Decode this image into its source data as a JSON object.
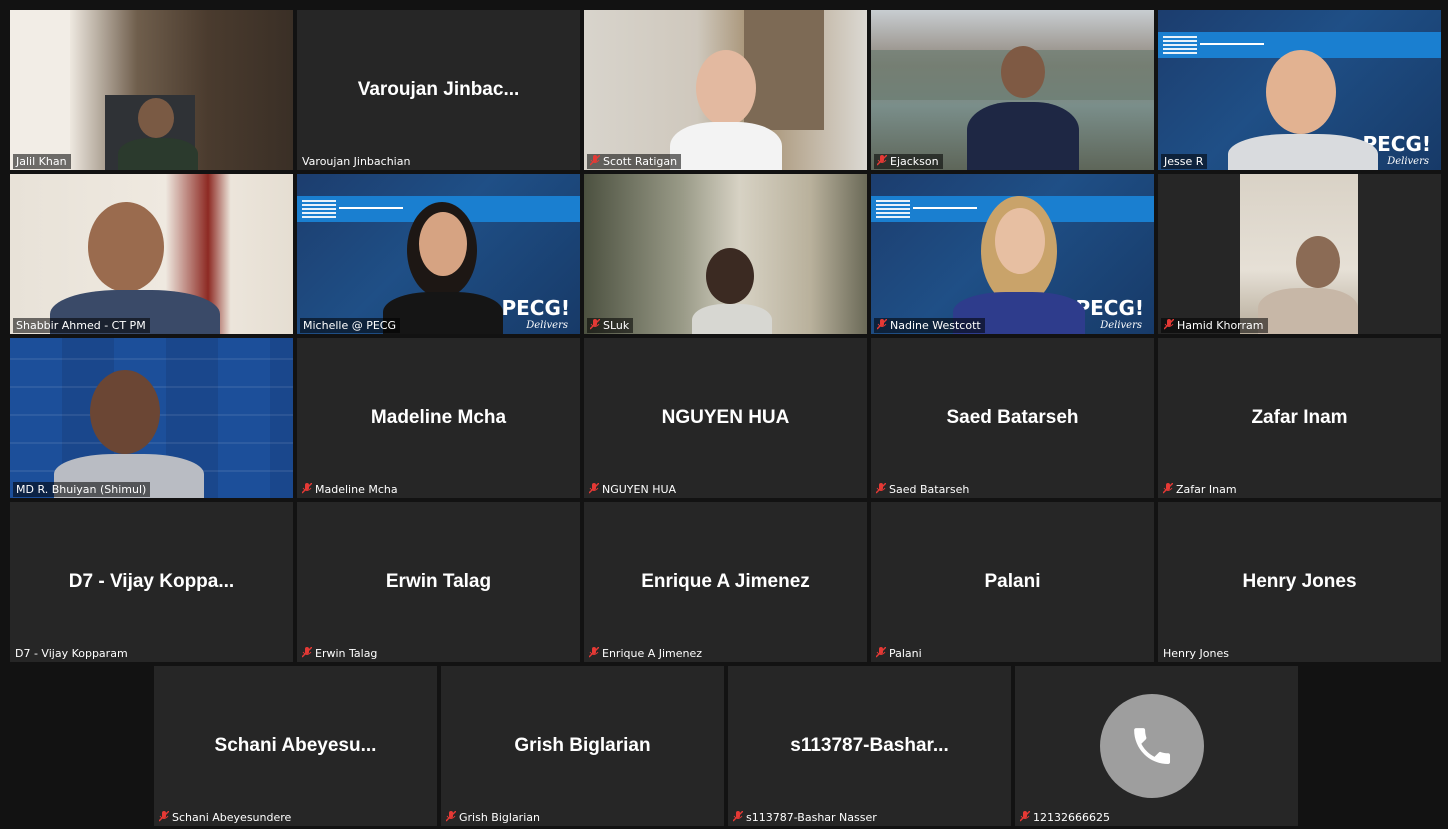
{
  "colors": {
    "background": "#121212",
    "tile": "#262626",
    "active_speaker_border": "#c4d67a",
    "muted_mic": "#e53935",
    "pecg_blue": "#1f4f86"
  },
  "participants": [
    {
      "label": "Jalil Khan",
      "muted": false,
      "video": true
    },
    {
      "display_name": "Varoujan  Jinbac...",
      "label": "Varoujan Jinbachian",
      "muted": false,
      "video": false
    },
    {
      "label": "Scott Ratigan",
      "muted": true,
      "video": true
    },
    {
      "label": "Ejackson",
      "muted": true,
      "video": true
    },
    {
      "label": "Jesse R",
      "muted": false,
      "video": true
    },
    {
      "label": "Shabbir Ahmed - CT PM",
      "muted": false,
      "video": true,
      "active_speaker": true
    },
    {
      "label": "Michelle @ PECG",
      "muted": false,
      "video": true
    },
    {
      "label": "SLuk",
      "muted": true,
      "video": true
    },
    {
      "label": "Nadine Westcott",
      "muted": true,
      "video": true
    },
    {
      "label": "Hamid Khorram",
      "muted": true,
      "video": true
    },
    {
      "label": "MD R. Bhuiyan (Shimul)",
      "muted": false,
      "video": true
    },
    {
      "display_name": "Madeline Mcha",
      "label": "Madeline Mcha",
      "muted": true,
      "video": false
    },
    {
      "display_name": "NGUYEN HUA",
      "label": "NGUYEN HUA",
      "muted": true,
      "video": false
    },
    {
      "display_name": "Saed Batarseh",
      "label": "Saed Batarseh",
      "muted": true,
      "video": false
    },
    {
      "display_name": "Zafar Inam",
      "label": "Zafar Inam",
      "muted": true,
      "video": false
    },
    {
      "display_name": "D7 - Vijay Koppa...",
      "label": "D7 - Vijay Kopparam",
      "muted": false,
      "video": false
    },
    {
      "display_name": "Erwin Talag",
      "label": "Erwin Talag",
      "muted": true,
      "video": false
    },
    {
      "display_name": "Enrique A Jimenez",
      "label": "Enrique A Jimenez",
      "muted": true,
      "video": false
    },
    {
      "display_name": "Palani",
      "label": "Palani",
      "muted": true,
      "video": false
    },
    {
      "display_name": "Henry Jones",
      "label": "Henry Jones",
      "muted": false,
      "video": false
    },
    {
      "display_name": "Schani  Abeyesu...",
      "label": "Schani Abeyesundere",
      "muted": true,
      "video": false
    },
    {
      "display_name": "Grish Biglarian",
      "label": "Grish Biglarian",
      "muted": true,
      "video": false
    },
    {
      "display_name": "s113787-Bashar...",
      "label": "s113787-Bashar Nasser",
      "muted": true,
      "video": false
    },
    {
      "label": "12132666625",
      "muted": true,
      "video": false,
      "phone": true
    }
  ],
  "backgrounds": {
    "pecg_mark": "PECG!",
    "pecg_sub": "Delivers"
  },
  "icons": {
    "muted": "muted-mic-icon",
    "phone": "phone-icon"
  }
}
